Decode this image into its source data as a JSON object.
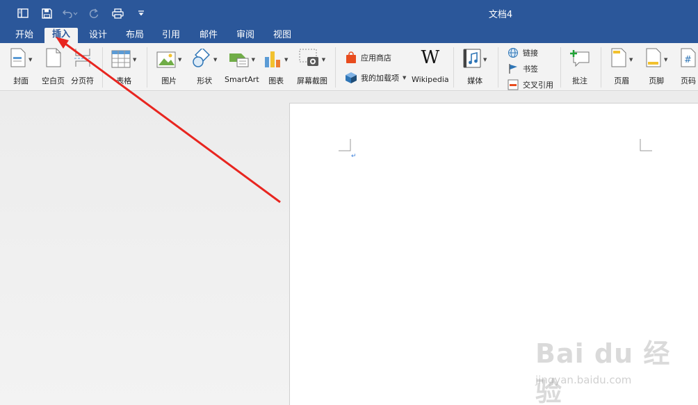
{
  "window": {
    "title": "文档4"
  },
  "quick_access": {
    "icons": [
      "sidebar-icon",
      "save-icon",
      "undo-icon",
      "redo-icon",
      "print-icon",
      "customize-icon"
    ]
  },
  "tabs": [
    {
      "label": "开始",
      "active": false
    },
    {
      "label": "插入",
      "active": true
    },
    {
      "label": "设计",
      "active": false
    },
    {
      "label": "布局",
      "active": false
    },
    {
      "label": "引用",
      "active": false
    },
    {
      "label": "邮件",
      "active": false
    },
    {
      "label": "审阅",
      "active": false
    },
    {
      "label": "视图",
      "active": false
    }
  ],
  "ribbon": {
    "cover": "封面",
    "blank_page": "空白页",
    "page_break": "分页符",
    "table": "表格",
    "picture": "图片",
    "shapes": "形状",
    "smartart": "SmartArt",
    "chart": "图表",
    "screenshot": "屏幕截图",
    "app_store": "应用商店",
    "my_addins": "我的加载项",
    "wikipedia": "Wikipedia",
    "media": "媒体",
    "link": "链接",
    "bookmark": "书签",
    "cross_reference": "交叉引用",
    "comment": "批注",
    "header": "页眉",
    "footer": "页脚",
    "page_number": "页码"
  },
  "watermark": {
    "logo": "Bai du 经验",
    "url": "jingyan.baidu.com"
  },
  "colors": {
    "title_bar": "#2b579a",
    "annotation_arrow": "#e8251f"
  }
}
